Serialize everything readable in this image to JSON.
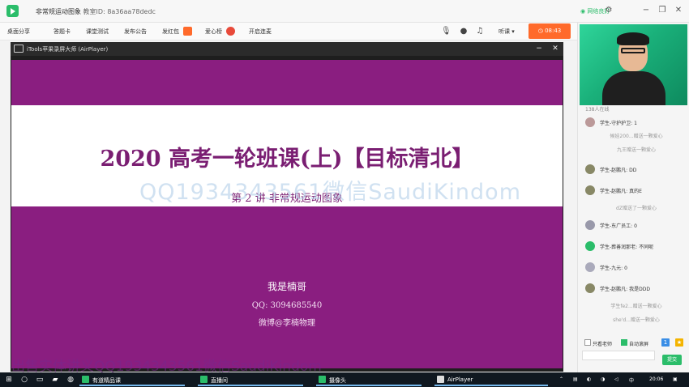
{
  "window": {
    "title": "非常规运动图象",
    "room_id_label": "教室ID:",
    "room_id": "8a36aa78dedc",
    "network_status": "网络良好"
  },
  "toolbar": {
    "items": [
      "桌面分享",
      "答题卡",
      "课堂测试",
      "发布公告",
      "发红包",
      "爱心榜",
      "开启连麦"
    ],
    "speaker_mode": "听课",
    "timer": "08:43"
  },
  "airplayer": {
    "title": "iTools苹果录屏大师 (AirPlayer)",
    "minimize": "−",
    "close": "✕"
  },
  "slide": {
    "title": "2020 高考一轮班课(上)【目标清北】",
    "subtitle": "第 2 讲  非常规运动图象",
    "presenter": "我是楠哥",
    "qq": "QQ:  3094685540",
    "weibo": "微博@李楠物理"
  },
  "watermarks": {
    "center": "QQ1934343561微信SaudiKindom",
    "bottom": "出售实体讲义QQ1934343561微信SaudiKindom"
  },
  "chat": {
    "online_count": "138人在线",
    "messages": [
      {
        "text": "学生-守护护卫: 1",
        "color": "#b99"
      },
      {
        "text": "学生-赵鹏凡: DD",
        "color": "#886"
      },
      {
        "text": "学生-赵鹏凡: 真的E",
        "color": "#886"
      },
      {
        "text": "学生-东广员工: 0",
        "color": "#99a"
      },
      {
        "text": "学生-葬善润那老: 不同呢",
        "color": "#2bbd6a"
      },
      {
        "text": "学生-九元: 0",
        "color": "#aab"
      },
      {
        "text": "学生-赵鹏凡: 我是DDD",
        "color": "#886"
      }
    ],
    "notes": [
      "候娃200...赠送一颗爱心",
      "九王赠送一颗爱心",
      "dZ赠送了一颗爱心",
      "学生fe2...赠送一颗爱心",
      "she'd...赠送一颗爱心"
    ],
    "only_teacher": "只看老师",
    "auto_scroll": "自动滚屏",
    "send": "提交"
  },
  "taskbar": {
    "apps": [
      "有道精品课",
      "直播间",
      "摄像头",
      "AirPlayer"
    ],
    "ime": "中",
    "time": "20:06"
  }
}
